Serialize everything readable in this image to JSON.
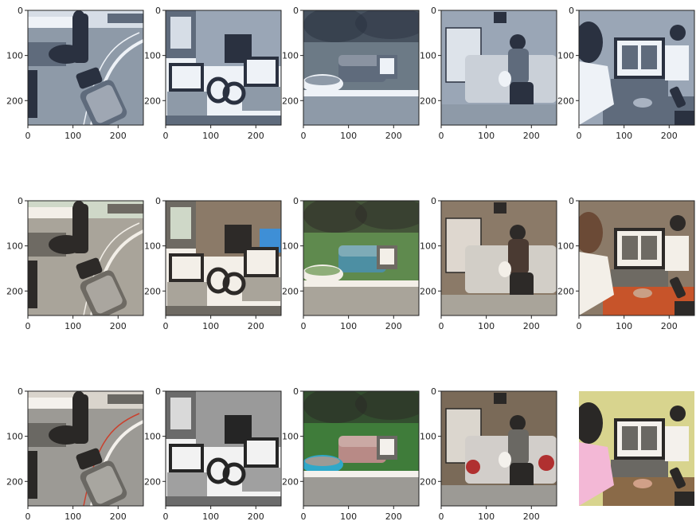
{
  "figure": {
    "rows": 3,
    "cols": 5,
    "axis_ticks": {
      "x": [
        "0",
        "100",
        "200"
      ],
      "y": [
        "0",
        "100",
        "200"
      ]
    },
    "panels": [
      {
        "row": 1,
        "col": 1,
        "scene": "street-person-luggage",
        "tone": "desaturated-blue",
        "axes_visible": true
      },
      {
        "row": 1,
        "col": 2,
        "scene": "laptops-fireplace-headphones",
        "tone": "desaturated-blue",
        "axes_visible": true
      },
      {
        "row": 1,
        "col": 3,
        "scene": "curb-sofa-tv-tub",
        "tone": "desaturated-blue",
        "axes_visible": true
      },
      {
        "row": 1,
        "col": 4,
        "scene": "woman-on-sofa-with-cat",
        "tone": "desaturated-blue",
        "axes_visible": true
      },
      {
        "row": 1,
        "col": 5,
        "scene": "person-at-laptop-desk",
        "tone": "desaturated-blue",
        "axes_visible": true
      },
      {
        "row": 2,
        "col": 1,
        "scene": "street-person-luggage",
        "tone": "color-1",
        "axes_visible": true
      },
      {
        "row": 2,
        "col": 2,
        "scene": "laptops-fireplace-headphones",
        "tone": "color-1",
        "axes_visible": true
      },
      {
        "row": 2,
        "col": 3,
        "scene": "curb-sofa-tv-tub",
        "tone": "color-1",
        "axes_visible": true
      },
      {
        "row": 2,
        "col": 4,
        "scene": "woman-on-sofa-with-cat",
        "tone": "color-1",
        "axes_visible": true
      },
      {
        "row": 2,
        "col": 5,
        "scene": "person-at-laptop-desk",
        "tone": "color-1",
        "axes_visible": true
      },
      {
        "row": 3,
        "col": 1,
        "scene": "street-person-luggage",
        "tone": "color-2",
        "axes_visible": true
      },
      {
        "row": 3,
        "col": 2,
        "scene": "laptops-fireplace-headphones",
        "tone": "grayscale",
        "axes_visible": true
      },
      {
        "row": 3,
        "col": 3,
        "scene": "curb-sofa-tv-tub",
        "tone": "color-2",
        "axes_visible": true
      },
      {
        "row": 3,
        "col": 4,
        "scene": "woman-on-sofa-with-cat",
        "tone": "color-2",
        "axes_visible": true
      },
      {
        "row": 3,
        "col": 5,
        "scene": "person-at-laptop-desk",
        "tone": "color-2",
        "axes_visible": false
      }
    ]
  },
  "palettes": {
    "desaturated-blue": {
      "sky": "#d6dde6",
      "ground": "#8e9aa8",
      "mid": "#5f6b7c",
      "dark": "#2a3140",
      "light": "#eef2f7",
      "accent": "#7d8da3",
      "skin": "#a9b3c2",
      "green": "#6c7a86",
      "wall": "#9aa6b6"
    },
    "color-1": {
      "sky": "#cfd8c8",
      "ground": "#a9a49a",
      "mid": "#6e6a63",
      "dark": "#2d2a28",
      "light": "#f3efe8",
      "accent": "#3e8fd6",
      "skin": "#c99f86",
      "green": "#5f8a4e",
      "wall": "#8b7a68"
    },
    "color-2": {
      "sky": "#d9d4cc",
      "ground": "#9c9a95",
      "mid": "#6a6863",
      "dark": "#2a2826",
      "light": "#f4f1ec",
      "accent": "#c47a70",
      "skin": "#d0a088",
      "green": "#3f7c3a",
      "wall": "#7a6a58"
    },
    "grayscale": {
      "sky": "#d9d9d9",
      "ground": "#a0a0a0",
      "mid": "#6b6b6b",
      "dark": "#252525",
      "light": "#f2f2f2",
      "accent": "#8a8a8a",
      "skin": "#b5b5b5",
      "green": "#7a7a7a",
      "wall": "#9a9a9a"
    }
  },
  "colors": {
    "axis": "#222222",
    "background": "#ffffff"
  }
}
